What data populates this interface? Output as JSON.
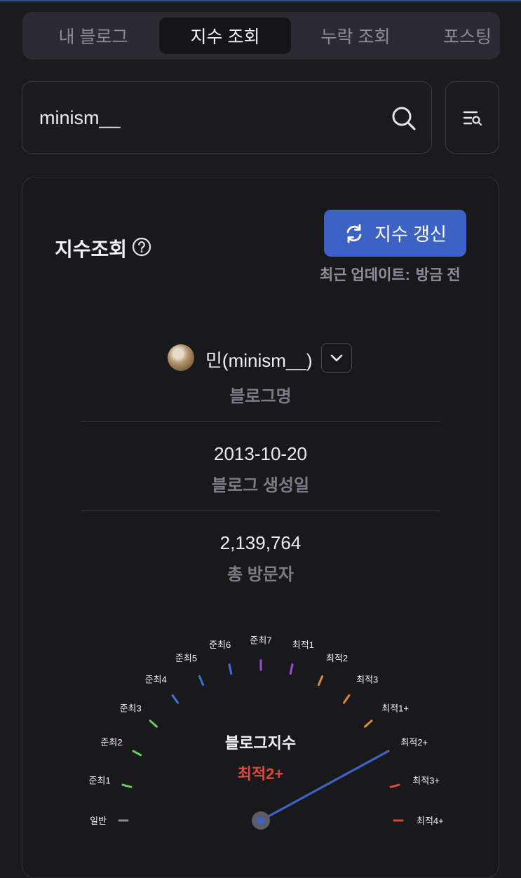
{
  "tabs": [
    {
      "label": "내 블로그",
      "active": false
    },
    {
      "label": "지수 조회",
      "active": true
    },
    {
      "label": "누락 조회",
      "active": false
    },
    {
      "label": "포스팅",
      "active": false
    }
  ],
  "search": {
    "value": "minism__"
  },
  "card": {
    "title": "지수조회",
    "refresh_label": "지수 갱신",
    "update_label": "최근 업데이트:",
    "update_value": "방금 전"
  },
  "profile": {
    "name": "민(minism__)",
    "name_label": "블로그명",
    "created_value": "2013-10-20",
    "created_label": "블로그 생성일",
    "visitors_value": "2,139,764",
    "visitors_label": "총 방문자"
  },
  "gauge": {
    "title": "블로그지수",
    "value": "최적2+",
    "value_color": "#e0473b",
    "needle_color": "#3c63c3",
    "current_level": "최적2+",
    "levels": [
      {
        "label": "일반",
        "color": "#8a8b90"
      },
      {
        "label": "준최1",
        "color": "#5fd35a"
      },
      {
        "label": "준최2",
        "color": "#5fd35a"
      },
      {
        "label": "준최3",
        "color": "#5fd35a"
      },
      {
        "label": "준최4",
        "color": "#3f72d6"
      },
      {
        "label": "준최5",
        "color": "#3f72d6"
      },
      {
        "label": "준최6",
        "color": "#3f72d6"
      },
      {
        "label": "준최7",
        "color": "#9b4ad6"
      },
      {
        "label": "최적1",
        "color": "#9b4ad6"
      },
      {
        "label": "최적2",
        "color": "#e08a35"
      },
      {
        "label": "최적3",
        "color": "#e08a35"
      },
      {
        "label": "최적1+",
        "color": "#e08a35"
      },
      {
        "label": "최적2+",
        "color": "#e0473b"
      },
      {
        "label": "최적3+",
        "color": "#e0473b"
      },
      {
        "label": "최적4+",
        "color": "#e0473b"
      }
    ]
  }
}
